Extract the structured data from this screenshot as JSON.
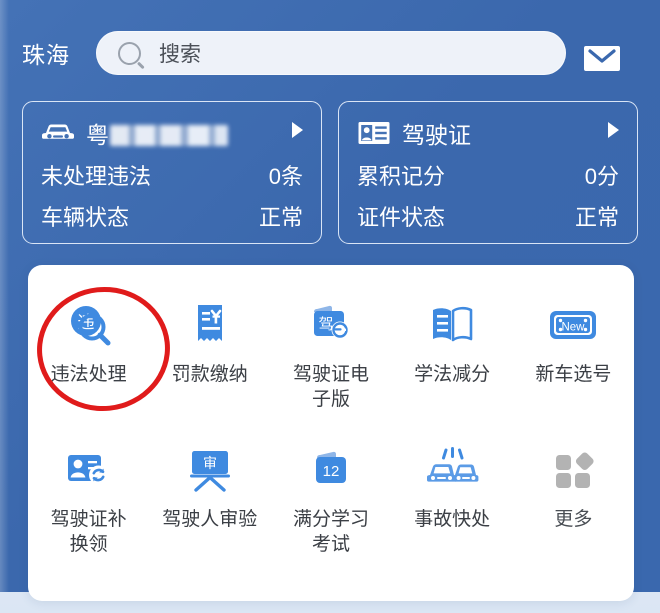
{
  "header": {
    "city": "珠海",
    "search_placeholder": "搜索",
    "search_icon": "search-icon",
    "mail_icon": "mail-icon"
  },
  "cards": [
    {
      "icon": "car-icon",
      "title_prefix": "粤",
      "title_masked": true,
      "chevron": "chevron-right-icon",
      "rows": [
        {
          "label": "未处理违法",
          "value": "0条"
        },
        {
          "label": "车辆状态",
          "value": "正常"
        }
      ]
    },
    {
      "icon": "id-card-icon",
      "title": "驾驶证",
      "chevron": "chevron-right-icon",
      "rows": [
        {
          "label": "累积记分",
          "value": "0分"
        },
        {
          "label": "证件状态",
          "value": "正常"
        }
      ]
    }
  ],
  "grid": {
    "items": [
      {
        "label": "违法处理",
        "icon": "violation-search-icon",
        "highlighted": true
      },
      {
        "label": "罚款缴纳",
        "icon": "receipt-yen-icon",
        "highlighted": false
      },
      {
        "label": "驾驶证电\n子版",
        "icon": "digital-license-icon",
        "highlighted": false
      },
      {
        "label": "学法减分",
        "icon": "open-book-icon",
        "highlighted": false
      },
      {
        "label": "新车选号",
        "icon": "new-plate-icon",
        "highlighted": false
      },
      {
        "label": "驾驶证补\n换领",
        "icon": "license-renew-icon",
        "highlighted": false
      },
      {
        "label": "驾驶人审验",
        "icon": "review-board-icon",
        "highlighted": false
      },
      {
        "label": "满分学习\n考试",
        "icon": "twelve-points-icon",
        "highlighted": false
      },
      {
        "label": "事故快处",
        "icon": "accident-cars-icon",
        "highlighted": false
      },
      {
        "label": "更多",
        "icon": "more-grid-icon",
        "highlighted": false
      }
    ]
  },
  "annotation": {
    "type": "red-circle",
    "target": "违法处理",
    "color": "#e01b1b"
  },
  "colors": {
    "background_blue": "#3d6cb0",
    "panel_white": "#ffffff",
    "icon_blue": "#3f8ae0",
    "icon_gray": "#b3b3b3",
    "search_field": "#eef2f9"
  }
}
